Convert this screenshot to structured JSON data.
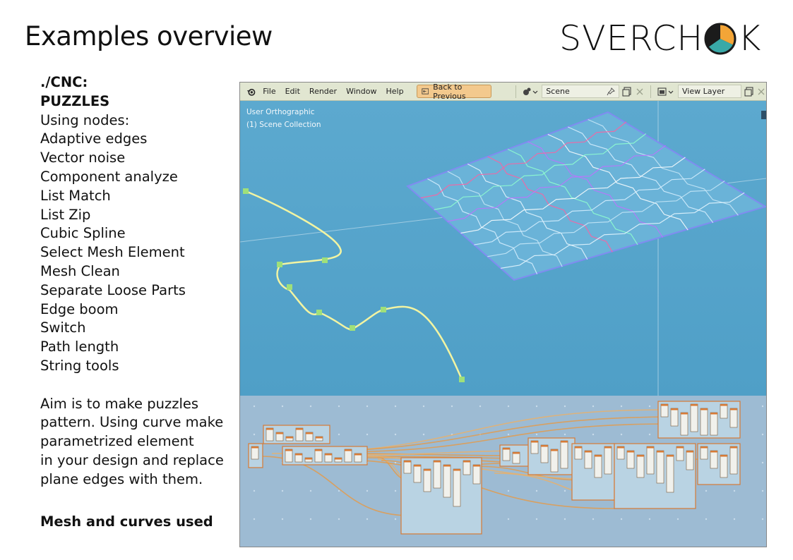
{
  "slide": {
    "title": "Examples overview",
    "logo_text": "SVERCH",
    "logo_last_letter": "K"
  },
  "description": {
    "path": "./CNC:",
    "name": "PUZZLES",
    "nodes_heading": "Using nodes:",
    "nodes": [
      "Adaptive edges",
      "Vector noise",
      "Component analyze",
      "List Match",
      "List Zip",
      "Cubic Spline",
      "Select Mesh Element",
      "Mesh Clean",
      "Separate Loose Parts",
      "Edge boom",
      "Switch",
      "Path length",
      "String tools"
    ],
    "aim_lines": [
      "Aim is to make puzzles",
      "pattern. Using curve make",
      "parametrized element",
      "in your design and replace",
      "plane edges with them."
    ],
    "footer": "Mesh and curves used"
  },
  "blender": {
    "menu": [
      "File",
      "Edit",
      "Render",
      "Window",
      "Help"
    ],
    "back_button": "Back to Previous",
    "scene_name": "Scene",
    "view_layer_name": "View Layer",
    "viewport_overlay_lines": [
      "User Orthographic",
      "(1) Scene Collection"
    ],
    "icons": [
      "blender-logo-icon",
      "back-icon",
      "scene-icon",
      "pin-icon",
      "copy-icon",
      "close-icon",
      "view-layer-icon"
    ],
    "colors": {
      "topbar": "#e1e6d1",
      "back_button": "#f3c98d",
      "viewport": "#5ca9cf",
      "node_editor": "#9dbbd3",
      "curve": "#f2f4a2",
      "curve_point": "#9fe07a",
      "node_frame": "#d67a36",
      "node_link": "#e39b4c"
    }
  }
}
